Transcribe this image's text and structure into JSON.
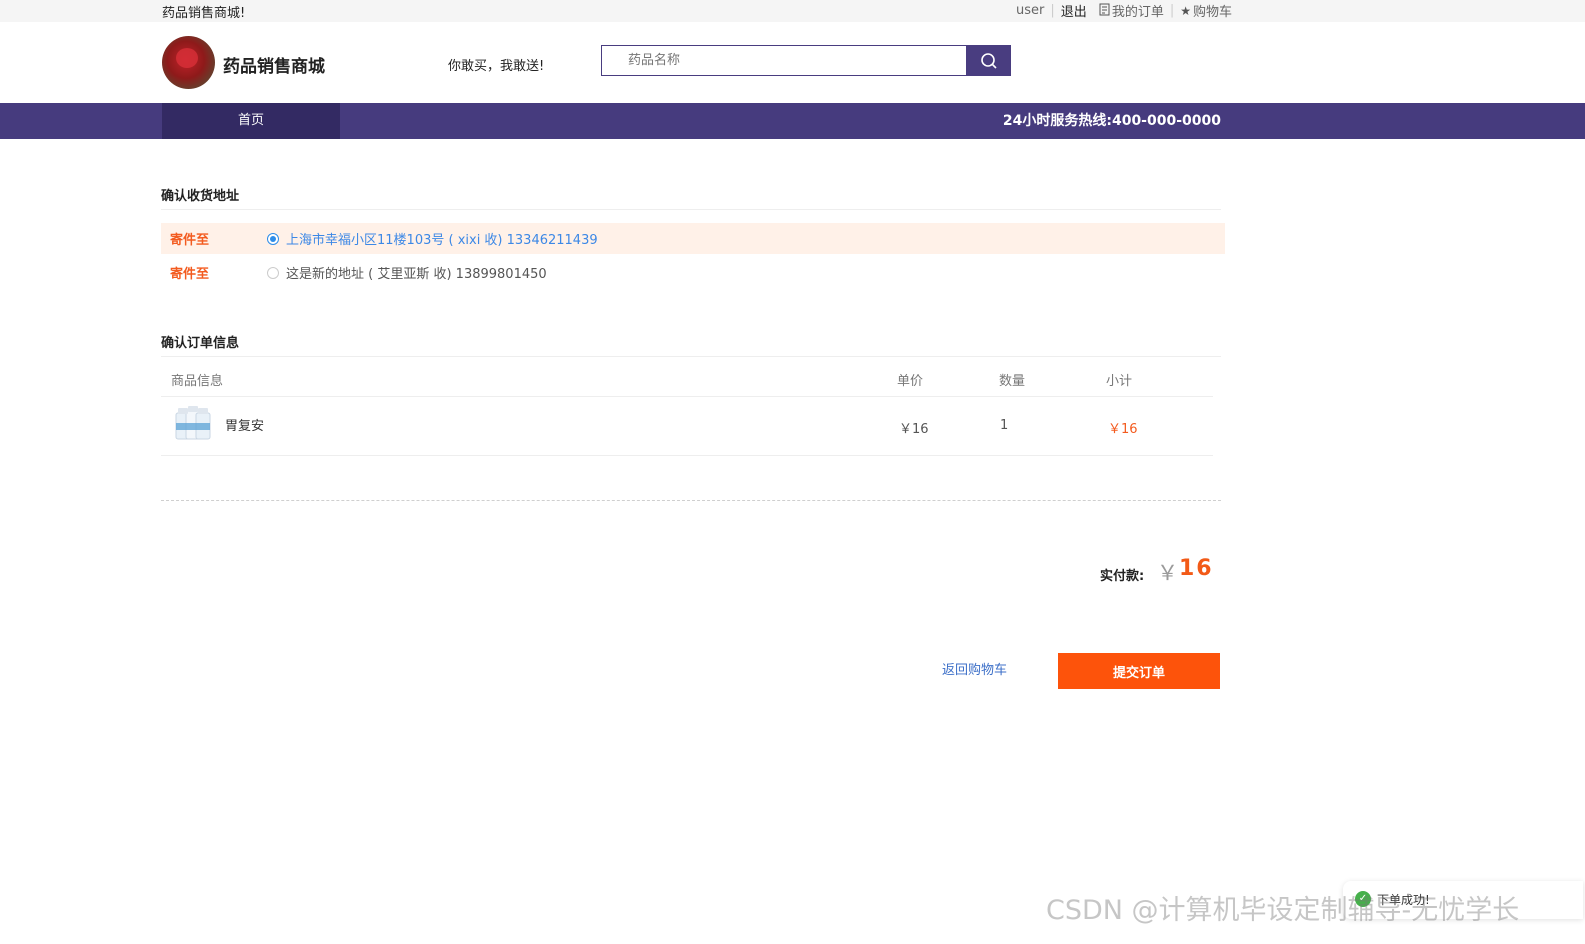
{
  "topbar": {
    "welcome": "药品销售商城!",
    "user": "user",
    "logout": "退出",
    "orders": "我的订单",
    "cart": "购物车"
  },
  "header": {
    "logo_text": "药品销售商城",
    "slogan": "你敢买，我敢送!",
    "search_placeholder": "药品名称"
  },
  "nav": {
    "home": "首页",
    "hotline": "24小时服务热线:400-000-0000"
  },
  "address": {
    "title": "确认收货地址",
    "items": [
      {
        "label": "寄件至",
        "text": "上海市幸福小区11楼103号 ( xixi 收)  13346211439",
        "selected": true
      },
      {
        "label": "寄件至",
        "text": "这是新的地址 ( 艾里亚斯 收)  13899801450",
        "selected": false
      }
    ]
  },
  "order": {
    "title": "确认订单信息",
    "headers": {
      "product": "商品信息",
      "price": "单价",
      "qty": "数量",
      "subtotal": "小计"
    },
    "item": {
      "name": "胃复安",
      "price": "￥16",
      "qty": "1",
      "subtotal": "￥16"
    }
  },
  "total": {
    "label": "实付款:",
    "currency": "￥",
    "value": "16"
  },
  "actions": {
    "back": "返回购物车",
    "submit": "提交订单"
  },
  "overlay": {
    "watermark": "CSDN @计算机毕设定制辅导-无忧学长",
    "toast": "下单成功!"
  },
  "colors": {
    "brand_purple": "#463b7e",
    "accent_orange": "#fd530b",
    "link_blue": "#3c88e6"
  }
}
